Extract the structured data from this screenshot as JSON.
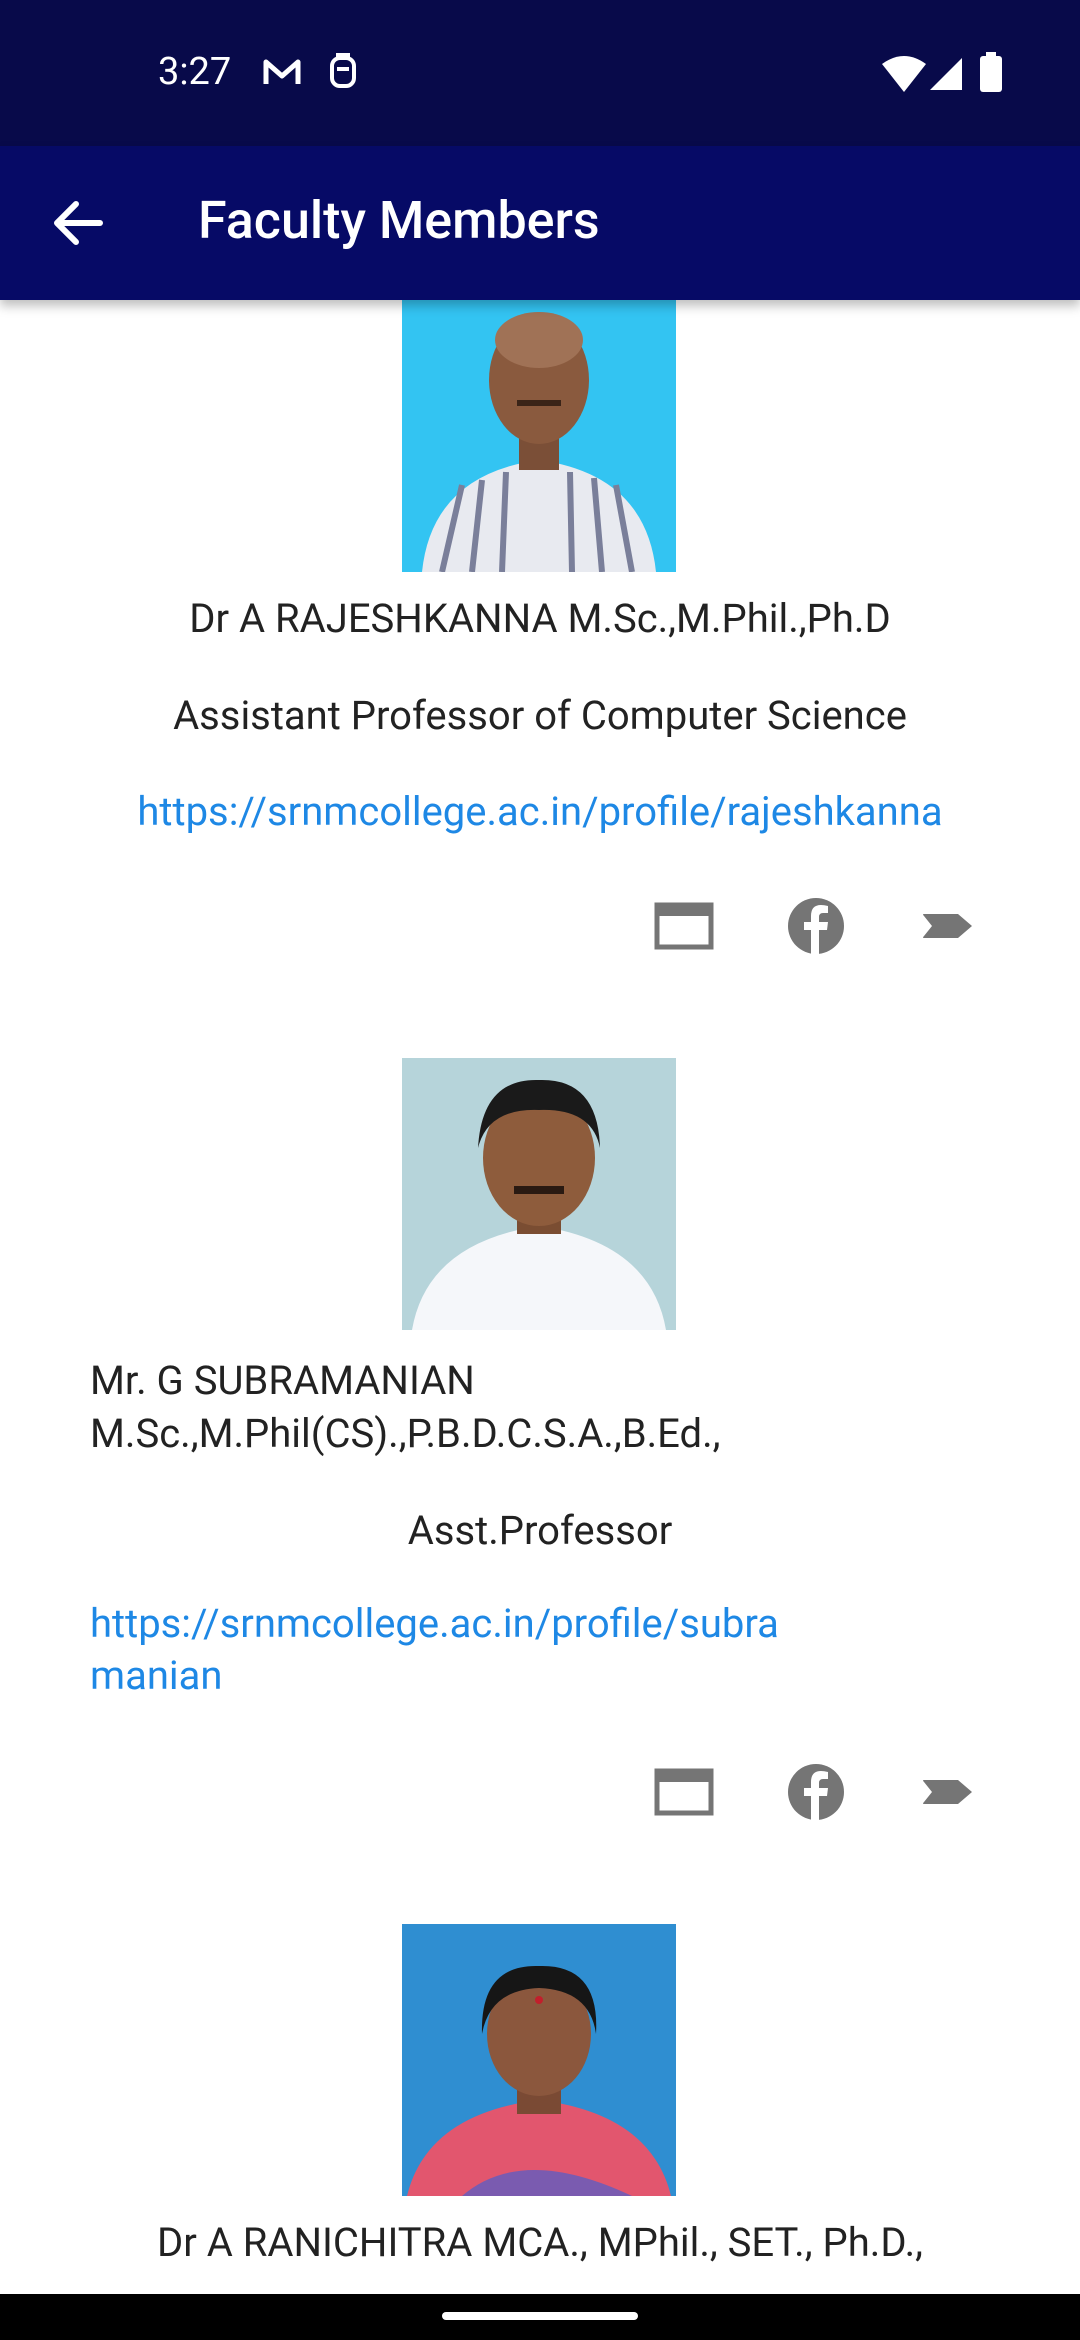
{
  "status": {
    "time": "3:27"
  },
  "app_bar": {
    "title": "Faculty Members"
  },
  "faculty": [
    {
      "name": "Dr A RAJESHKANNA M.Sc.,M.Phil.,Ph.D",
      "designation": "Assistant Professor of Computer Science",
      "link": "https://srnmcollege.ac.in/profile/rajeshkanna"
    },
    {
      "name": "Mr. G SUBRAMANIAN M.Sc.,M.Phil(CS).,P.B.D.C.S.A.,B.Ed.,",
      "designation": "Asst.Professor",
      "link": "https://srnmcollege.ac.in/profile/subramanian"
    },
    {
      "name": "Dr A RANICHITRA MCA., MPhil., SET., Ph.D.,"
    }
  ],
  "icons": {
    "open": "open-in-browser-icon",
    "facebook": "facebook-icon",
    "tag": "label-icon"
  },
  "colors": {
    "status_bar": "#080a4a",
    "app_bar": "#060a66",
    "link": "#1e88e5"
  }
}
